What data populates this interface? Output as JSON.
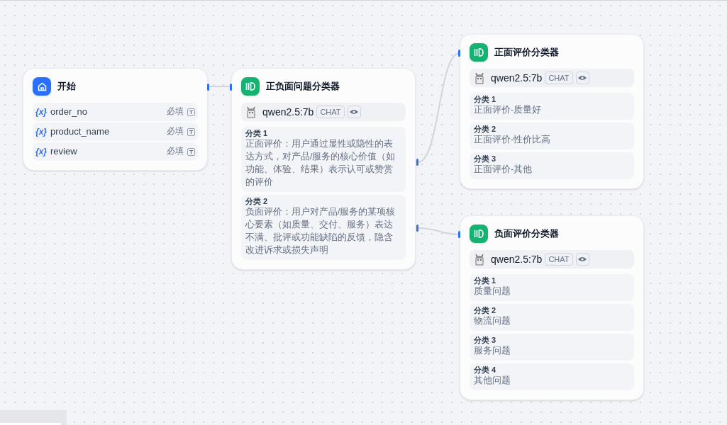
{
  "start_node": {
    "title": "开始",
    "variables": [
      {
        "icon": "{x}",
        "name": "order_no",
        "required": "必填"
      },
      {
        "icon": "{x}",
        "name": "product_name",
        "required": "必填"
      },
      {
        "icon": "{x}",
        "name": "review",
        "required": "必填"
      }
    ]
  },
  "classifier_nodes": [
    {
      "title": "正负面问题分类器",
      "model": "qwen2.5:7b",
      "mode": "CHAT",
      "classes": [
        {
          "label": "分类 1",
          "text": "正面评价：用户通过显性或隐性的表达方式，对产品/服务的核心价值（如功能、体验、结果）表示认可或赞赏的评价"
        },
        {
          "label": "分类 2",
          "text": "负面评价：用户对产品/服务的某项核心要素（如质量、交付、服务）表达不满、批评或功能缺陷的反馈，隐含改进诉求或损失声明"
        }
      ]
    },
    {
      "title": "正面评价分类器",
      "model": "qwen2.5:7b",
      "mode": "CHAT",
      "classes": [
        {
          "label": "分类 1",
          "text": "正面评价-质量好"
        },
        {
          "label": "分类 2",
          "text": "正面评价-性价比高"
        },
        {
          "label": "分类 3",
          "text": "正面评价-其他"
        }
      ]
    },
    {
      "title": "负面评价分类器",
      "model": "qwen2.5:7b",
      "mode": "CHAT",
      "classes": [
        {
          "label": "分类 1",
          "text": "质量问题"
        },
        {
          "label": "分类 2",
          "text": "物流问题"
        },
        {
          "label": "分类 3",
          "text": "服务问题"
        },
        {
          "label": "分类 4",
          "text": "其他问题"
        }
      ]
    }
  ]
}
